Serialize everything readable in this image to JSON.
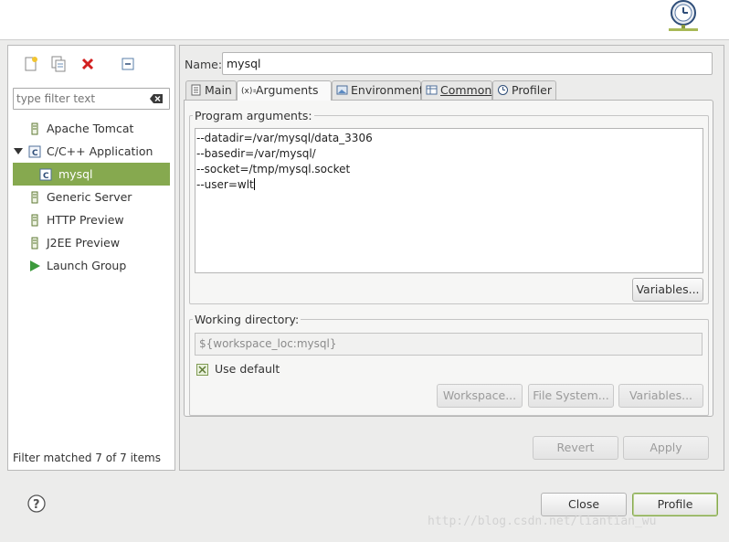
{
  "left": {
    "filter_placeholder": "type filter text",
    "tree": [
      {
        "label": "Apache Tomcat",
        "icon": "server-icon"
      },
      {
        "label": "C/C++ Application",
        "icon": "c-app-icon",
        "expanded": true
      },
      {
        "label": "mysql",
        "icon": "c-file-icon",
        "selected": true
      },
      {
        "label": "Generic Server",
        "icon": "server-icon"
      },
      {
        "label": "HTTP Preview",
        "icon": "server-icon"
      },
      {
        "label": "J2EE Preview",
        "icon": "server-icon"
      },
      {
        "label": "Launch Group",
        "icon": "launch-icon"
      }
    ],
    "status": "Filter matched 7 of 7 items"
  },
  "right": {
    "name_label": "Name:",
    "name_value": "mysql",
    "tabs": [
      {
        "label": "Main",
        "icon": "document-icon"
      },
      {
        "label": "Arguments",
        "icon": "variable-icon",
        "active": true
      },
      {
        "label": "Environment",
        "icon": "environment-icon"
      },
      {
        "label": "Common",
        "icon": "table-icon"
      },
      {
        "label": "Profiler",
        "icon": "clock-icon"
      }
    ],
    "program_args_title": "Program arguments:",
    "program_args": "--datadir=/var/mysql/data_3306\n--basedir=/var/mysql/\n--socket=/tmp/mysql.socket\n--user=wlt",
    "variables_label": "Variables...",
    "working_dir_title": "Working directory:",
    "working_dir_value": "${workspace_loc:mysql}",
    "use_default_label": "Use default",
    "workspace_label": "Workspace...",
    "filesystem_label": "File System...",
    "variables2_label": "Variables...",
    "revert_label": "Revert",
    "apply_label": "Apply"
  },
  "footer": {
    "close_label": "Close",
    "profile_label": "Profile",
    "watermark": "http://blog.csdn.net/liantian_wu"
  },
  "colors": {
    "accent": "#86a94f",
    "background": "#ececeb"
  }
}
